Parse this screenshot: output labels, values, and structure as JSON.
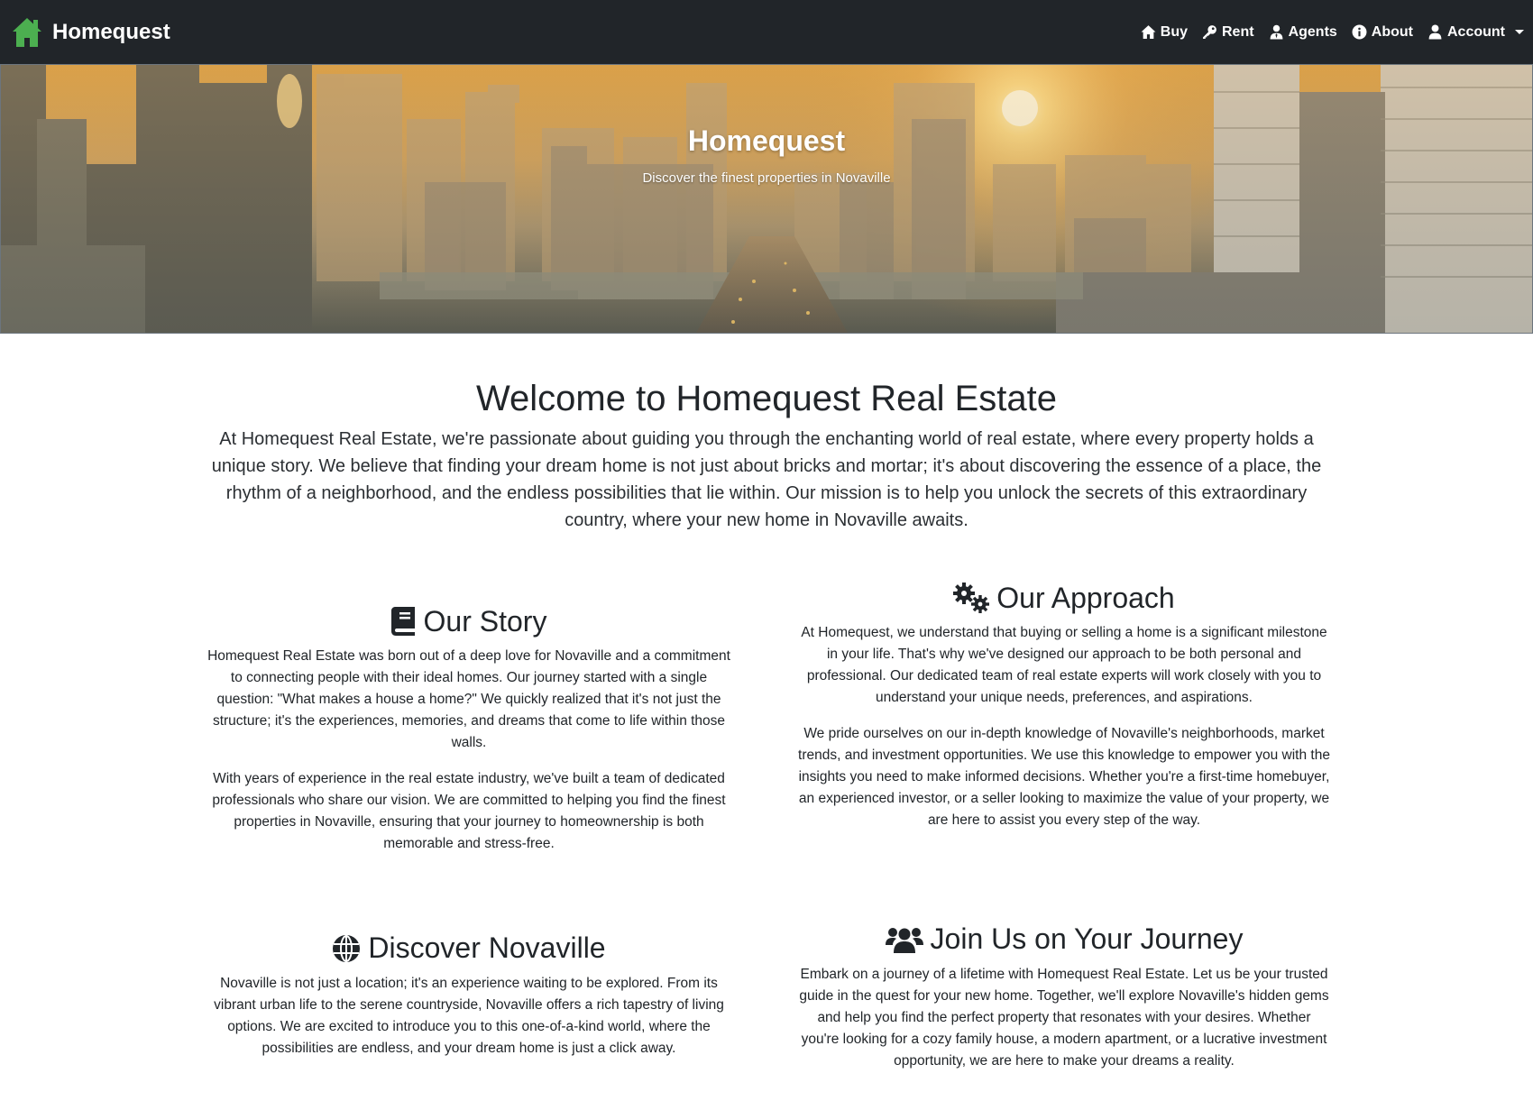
{
  "navbar": {
    "brand": "Homequest",
    "links": [
      {
        "label": "Buy",
        "icon": "home-icon"
      },
      {
        "label": "Rent",
        "icon": "key-icon"
      },
      {
        "label": "Agents",
        "icon": "agent-icon"
      },
      {
        "label": "About",
        "icon": "info-icon"
      },
      {
        "label": "Account",
        "icon": "user-icon"
      }
    ]
  },
  "hero": {
    "title": "Homequest",
    "subtitle": "Discover the finest properties in Novaville"
  },
  "welcome": {
    "title": "Welcome to Homequest Real Estate",
    "lead": "At Homequest Real Estate, we're passionate about guiding you through the enchanting world of real estate, where every property holds a unique story. We believe that finding your dream home is not just about bricks and mortar; it's about discovering the essence of a place, the rhythm of a neighborhood, and the endless possibilities that lie within. Our mission is to help you unlock the secrets of this extraordinary country, where your new home in Novaville awaits."
  },
  "sections": {
    "story": {
      "title": "Our Story",
      "p1": "Homequest Real Estate was born out of a deep love for Novaville and a commitment to connecting people with their ideal homes. Our journey started with a single question: \"What makes a house a home?\" We quickly realized that it's not just the structure; it's the experiences, memories, and dreams that come to life within those walls.",
      "p2": "With years of experience in the real estate industry, we've built a team of dedicated professionals who share our vision. We are committed to helping you find the finest properties in Novaville, ensuring that your journey to homeownership is both memorable and stress-free."
    },
    "approach": {
      "title": "Our Approach",
      "p1": "At Homequest, we understand that buying or selling a home is a significant milestone in your life. That's why we've designed our approach to be both personal and professional. Our dedicated team of real estate experts will work closely with you to understand your unique needs, preferences, and aspirations.",
      "p2": "We pride ourselves on our in-depth knowledge of Novaville's neighborhoods, market trends, and investment opportunities. We use this knowledge to empower you with the insights you need to make informed decisions. Whether you're a first-time homebuyer, an experienced investor, or a seller looking to maximize the value of your property, we are here to assist you every step of the way."
    },
    "discover": {
      "title": "Discover Novaville",
      "p1": "Novaville is not just a location; it's an experience waiting to be explored. From its vibrant urban life to the serene countryside, Novaville offers a rich tapestry of living options. We are excited to introduce you to this one-of-a-kind world, where the possibilities are endless, and your dream home is just a click away."
    },
    "join": {
      "title": "Join Us on Your Journey",
      "p1": "Embark on a journey of a lifetime with Homequest Real Estate. Let us be your trusted guide in the quest for your new home. Together, we'll explore Novaville's hidden gems and help you find the perfect property that resonates with your desires. Whether you're looking for a cozy family house, a modern apartment, or a lucrative investment opportunity, we are here to make your dreams a reality."
    }
  },
  "colors": {
    "navbar_bg": "#212529",
    "logo_green": "#4caf50",
    "text": "#212529"
  }
}
